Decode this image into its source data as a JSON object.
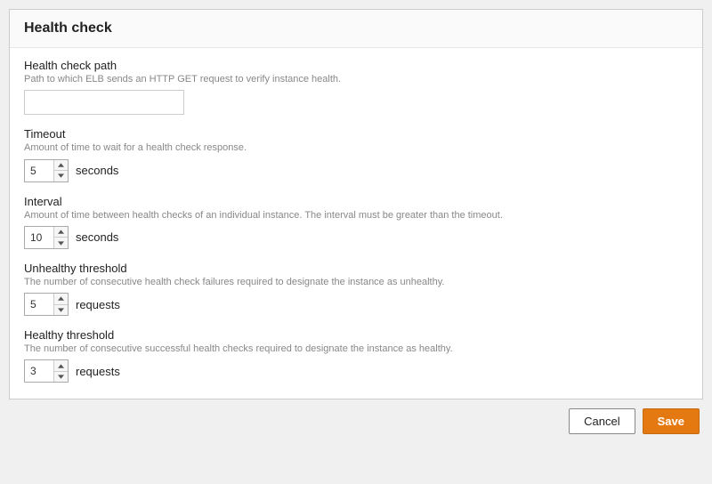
{
  "panel": {
    "title": "Health check"
  },
  "fields": {
    "path": {
      "label": "Health check path",
      "help": "Path to which ELB sends an HTTP GET request to verify instance health.",
      "value": ""
    },
    "timeout": {
      "label": "Timeout",
      "help": "Amount of time to wait for a health check response.",
      "value": "5",
      "unit": "seconds"
    },
    "interval": {
      "label": "Interval",
      "help": "Amount of time between health checks of an individual instance. The interval must be greater than the timeout.",
      "value": "10",
      "unit": "seconds"
    },
    "unhealthy": {
      "label": "Unhealthy threshold",
      "help": "The number of consecutive health check failures required to designate the instance as unhealthy.",
      "value": "5",
      "unit": "requests"
    },
    "healthy": {
      "label": "Healthy threshold",
      "help": "The number of consecutive successful health checks required to designate the instance as healthy.",
      "value": "3",
      "unit": "requests"
    }
  },
  "buttons": {
    "cancel": "Cancel",
    "save": "Save"
  }
}
